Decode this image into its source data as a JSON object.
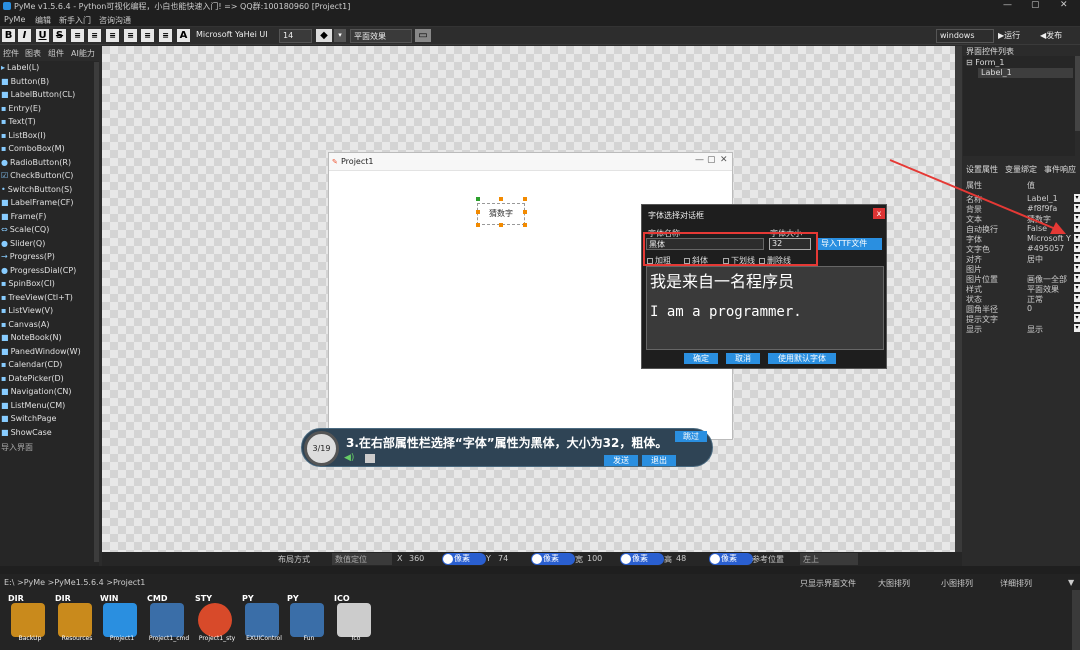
{
  "window": {
    "title": "PyMe v1.5.6.4 - Python可视化编程，小白也能快速入门! => QQ群:100180960   [Project1]",
    "min": "—",
    "max": "▢",
    "close": "✕"
  },
  "menu": [
    "PyMe",
    "编辑",
    "新手入门",
    "咨询沟通"
  ],
  "toolbar": {
    "buttons": [
      "B",
      "I",
      "U",
      "S"
    ],
    "font_name": "Microsoft YaHei UI",
    "font_size": "14",
    "effect": "平面效果",
    "platform": "windows",
    "run": "▶运行",
    "publish": "◀发布"
  },
  "left_tabs": [
    "控件",
    "图表",
    "组件",
    "AI能力"
  ],
  "widgets": [
    "Label(L)",
    "Button(B)",
    "LabelButton(CL)",
    "Entry(E)",
    "Text(T)",
    "ListBox(I)",
    "ComboBox(M)",
    "RadioButton(R)",
    "CheckButton(C)",
    "SwitchButton(S)",
    "LabelFrame(CF)",
    "Frame(F)",
    "Scale(CQ)",
    "Slider(Q)",
    "Progress(P)",
    "ProgressDial(CP)",
    "SpinBox(CI)",
    "TreeView(Ctl+T)",
    "ListView(V)",
    "Canvas(A)",
    "NoteBook(N)",
    "PanedWindow(W)",
    "Calendar(CD)",
    "DatePicker(D)",
    "Navigation(CN)",
    "ListMenu(CM)",
    "SwitchPage",
    "ShowCase",
    "导入界面"
  ],
  "form": {
    "title": "Project1",
    "label_text": "猜数字",
    "min": "—",
    "max": "▢",
    "close": "✕"
  },
  "tutorial": {
    "step": "3/19",
    "text": "3.在右部属性栏选择“字体”属性为黑体，大小为32，粗体。",
    "skip": "跳过",
    "send": "发送",
    "exit": "退出"
  },
  "font_dialog": {
    "title": "字体选择对话框",
    "close": "x",
    "name_label": "字体名称",
    "size_label": "字体大小",
    "name_value": "黑体",
    "size_value": "32",
    "import_ttf": "导入TTF文件",
    "bold": "加粗",
    "italic": "斜体",
    "underline": "下划线",
    "strike": "删除线",
    "preview_cn": "我是来自一名程序员",
    "preview_en": "I am a programmer.",
    "ok": "确定",
    "cancel": "取消",
    "default": "使用默认字体"
  },
  "right": {
    "tree_header": "界面控件列表",
    "tree_root": "⊟ Form_1",
    "tree_child": "Label_1",
    "tabs": [
      "设置属性",
      "变量绑定",
      "事件响应"
    ],
    "col_attr": "属性",
    "col_val": "值",
    "props": [
      {
        "k": "名称",
        "v": "Label_1"
      },
      {
        "k": "背景",
        "v": "#f8f9fa"
      },
      {
        "k": "文本",
        "v": "猜数字"
      },
      {
        "k": "自动换行",
        "v": "False"
      },
      {
        "k": "字体",
        "v": "Microsoft Y"
      },
      {
        "k": "文字色",
        "v": "#495057"
      },
      {
        "k": "对齐",
        "v": "居中"
      },
      {
        "k": "图片",
        "v": ""
      },
      {
        "k": "图片位置",
        "v": "画像一全部"
      },
      {
        "k": "样式",
        "v": "平面效果"
      },
      {
        "k": "状态",
        "v": "正常"
      },
      {
        "k": "圆角半径",
        "v": "0"
      },
      {
        "k": "提示文字",
        "v": ""
      },
      {
        "k": "显示",
        "v": "显示"
      }
    ]
  },
  "status": {
    "layout": "布局方式",
    "layout_val": "数值定位",
    "x_label": "X",
    "x_val": "360",
    "unit": "像素",
    "y_label": "Y",
    "y_val": "74",
    "w_label": "宽",
    "w_val": "100",
    "h_label": "高",
    "h_val": "48",
    "ref_label": "参考位置",
    "ref_val": "左上"
  },
  "path": "E:\\ >PyMe >PyMe1.5.6.4 >Project1",
  "view_opts": [
    "只显示界面文件",
    "大图排列",
    "小图排列",
    "详细排列"
  ],
  "files": [
    {
      "tag": "DIR",
      "name": "BackUp",
      "color": "#c98a1c"
    },
    {
      "tag": "DIR",
      "name": "Resources",
      "color": "#c98a1c"
    },
    {
      "tag": "WIN",
      "name": "Project1",
      "color": "#2a8fe0"
    },
    {
      "tag": "CMD",
      "name": "Project1_cmd",
      "color": "#3a6ea8"
    },
    {
      "tag": "STY",
      "name": "Project1_sty",
      "color": "#d84a2a"
    },
    {
      "tag": "PY",
      "name": "EXUIControl",
      "color": "#3a6ea8"
    },
    {
      "tag": "PY",
      "name": "Fun",
      "color": "#3a6ea8"
    },
    {
      "tag": "ICO",
      "name": "Ico",
      "color": "#cccccc"
    }
  ],
  "colors": {
    "accent": "#2a8fe0",
    "highlight": "#e53935",
    "handle": "#f28a00"
  }
}
